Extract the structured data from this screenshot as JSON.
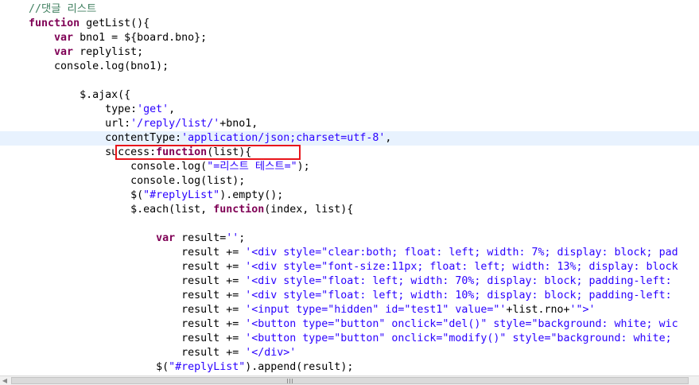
{
  "editor": {
    "lines": [
      {
        "indent": "    ",
        "tokens": [
          {
            "t": "//댓글 리스트",
            "c": "comment"
          }
        ]
      },
      {
        "indent": "    ",
        "tokens": [
          {
            "t": "function",
            "c": "keyword"
          },
          {
            "t": " getList(){",
            "c": "plain"
          }
        ]
      },
      {
        "indent": "        ",
        "tokens": [
          {
            "t": "var",
            "c": "keyword"
          },
          {
            "t": " bno1 = ${board.bno};",
            "c": "plain"
          }
        ]
      },
      {
        "indent": "        ",
        "tokens": [
          {
            "t": "var",
            "c": "keyword"
          },
          {
            "t": " replylist;",
            "c": "plain"
          }
        ]
      },
      {
        "indent": "        ",
        "tokens": [
          {
            "t": "console.log(bno1);",
            "c": "plain"
          }
        ]
      },
      {
        "indent": "",
        "tokens": []
      },
      {
        "indent": "            ",
        "tokens": [
          {
            "t": "$.ajax({",
            "c": "plain"
          }
        ]
      },
      {
        "indent": "                ",
        "tokens": [
          {
            "t": "type:",
            "c": "plain"
          },
          {
            "t": "'get'",
            "c": "string"
          },
          {
            "t": ",",
            "c": "plain"
          }
        ]
      },
      {
        "indent": "                ",
        "tokens": [
          {
            "t": "url:",
            "c": "plain"
          },
          {
            "t": "'/reply/list/'",
            "c": "string"
          },
          {
            "t": "+bno1,",
            "c": "plain"
          }
        ]
      },
      {
        "indent": "                ",
        "current": true,
        "tokens": [
          {
            "t": "contentType:",
            "c": "plain"
          },
          {
            "t": "'application/json;charset=utf-8'",
            "c": "string"
          },
          {
            "t": ",",
            "c": "plain"
          }
        ]
      },
      {
        "indent": "                ",
        "tokens": [
          {
            "t": "success:",
            "c": "plain"
          },
          {
            "t": "function",
            "c": "keyword"
          },
          {
            "t": "(list){",
            "c": "plain"
          }
        ]
      },
      {
        "indent": "                    ",
        "tokens": [
          {
            "t": "console.log(",
            "c": "plain"
          },
          {
            "t": "\"=리스트 테스트=\"",
            "c": "string"
          },
          {
            "t": ");",
            "c": "plain"
          }
        ]
      },
      {
        "indent": "                    ",
        "tokens": [
          {
            "t": "console.log(list);",
            "c": "plain"
          }
        ]
      },
      {
        "indent": "                    ",
        "tokens": [
          {
            "t": "$(",
            "c": "plain"
          },
          {
            "t": "\"#replyList\"",
            "c": "string"
          },
          {
            "t": ").empty();",
            "c": "plain"
          }
        ]
      },
      {
        "indent": "                    ",
        "tokens": [
          {
            "t": "$.each(list, ",
            "c": "plain"
          },
          {
            "t": "function",
            "c": "keyword"
          },
          {
            "t": "(index, list){",
            "c": "plain"
          }
        ]
      },
      {
        "indent": "",
        "tokens": []
      },
      {
        "indent": "                        ",
        "tokens": [
          {
            "t": "var",
            "c": "keyword"
          },
          {
            "t": " result=",
            "c": "plain"
          },
          {
            "t": "''",
            "c": "string"
          },
          {
            "t": ";",
            "c": "plain"
          }
        ]
      },
      {
        "indent": "                            ",
        "tokens": [
          {
            "t": "result += ",
            "c": "plain"
          },
          {
            "t": "'<div style=\"clear:both; float: left; width: 7%; display: block; pad",
            "c": "string"
          }
        ]
      },
      {
        "indent": "                            ",
        "tokens": [
          {
            "t": "result += ",
            "c": "plain"
          },
          {
            "t": "'<div style=\"font-size:11px; float: left; width: 13%; display: block",
            "c": "string"
          }
        ]
      },
      {
        "indent": "                            ",
        "tokens": [
          {
            "t": "result += ",
            "c": "plain"
          },
          {
            "t": "'<div style=\"float: left; width: 70%; display: block; padding-left:",
            "c": "string"
          }
        ]
      },
      {
        "indent": "                            ",
        "tokens": [
          {
            "t": "result += ",
            "c": "plain"
          },
          {
            "t": "'<div style=\"float: left; width: 10%; display: block; padding-left:",
            "c": "string"
          }
        ]
      },
      {
        "indent": "                            ",
        "tokens": [
          {
            "t": "result += ",
            "c": "plain"
          },
          {
            "t": "'<input type=\"hidden\" id=\"test1\" value=\"'",
            "c": "string"
          },
          {
            "t": "+list.rno+",
            "c": "plain"
          },
          {
            "t": "'\">'",
            "c": "string"
          }
        ]
      },
      {
        "indent": "                            ",
        "tokens": [
          {
            "t": "result += ",
            "c": "plain"
          },
          {
            "t": "'<button type=\"button\" onclick=\"del()\" style=\"background: white; wic",
            "c": "string"
          }
        ]
      },
      {
        "indent": "                            ",
        "tokens": [
          {
            "t": "result += ",
            "c": "plain"
          },
          {
            "t": "'<button type=\"button\" onclick=\"modify()\" style=\"background: white;",
            "c": "string"
          }
        ]
      },
      {
        "indent": "                            ",
        "tokens": [
          {
            "t": "result += ",
            "c": "plain"
          },
          {
            "t": "'</div>'",
            "c": "string"
          }
        ]
      },
      {
        "indent": "                        ",
        "tokens": [
          {
            "t": "$(",
            "c": "plain"
          },
          {
            "t": "\"#replyList\"",
            "c": "string"
          },
          {
            "t": ").append(result);",
            "c": "plain"
          }
        ]
      }
    ]
  },
  "colors": {
    "comment": "#3f7f5f",
    "keyword": "#7f0055",
    "string": "#2a00ff",
    "current_line": "#e8f2fe",
    "highlight_box": "#e8151b"
  },
  "scrollbar": {
    "left_arrow_icon": "◀",
    "grip_icon": "grip-lines"
  }
}
